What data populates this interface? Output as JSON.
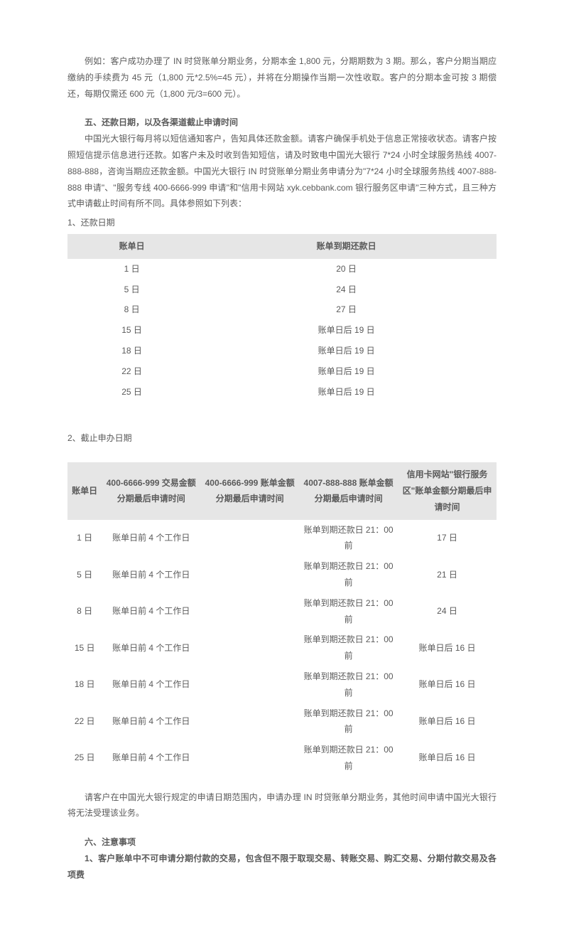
{
  "intro": "例如：客户成功办理了 IN 时贷账单分期业务，分期本金 1,800 元，分期期数为 3 期。那么，客户分期当期应缴纳的手续费为 45 元（1,800 元*2.5%=45 元），并将在分期操作当期一次性收取。客户的分期本金可按 3 期偿还，每期仅需还 600 元（1,800 元/3=600 元）。",
  "section5": {
    "title": "五、还款日期，以及各渠道截止申请时间",
    "body": "中国光大银行每月将以短信通知客户，告知具体还款金额。请客户确保手机处于信息正常接收状态。请客户按照短信提示信息进行还款。如客户未及时收到告知短信，请及时致电中国光大银行 7*24 小时全球服务热线 4007-888-888，咨询当期应还款金额。中国光大银行 IN 时贷账单分期业务申请分为\"7*24 小时全球服务热线 4007-888-888 申请\"、\"服务专线 400-6666-999 申请\"和\"信用卡网站 xyk.cebbank.com 银行服务区申请\"三种方式，且三种方式申请截止时间有所不同。具体参照如下列表：",
    "label1": "1、还款日期",
    "table1": {
      "headers": [
        "账单日",
        "账单到期还款日"
      ],
      "rows": [
        [
          "1 日",
          "20 日"
        ],
        [
          "5 日",
          "24 日"
        ],
        [
          "8 日",
          "27 日"
        ],
        [
          "15 日",
          "账单日后 19 日"
        ],
        [
          "18 日",
          "账单日后 19 日"
        ],
        [
          "22 日",
          "账单日后 19 日"
        ],
        [
          "25 日",
          "账单日后 19 日"
        ]
      ]
    },
    "label2": "2、截止申办日期",
    "table2": {
      "headers": [
        "账单日",
        "400-6666-999 交易金额分期最后申请时间",
        "400-6666-999 账单金额分期最后申请时间",
        "4007-888-888 账单金额分期最后申请时间",
        "信用卡网站\"银行服务区\"账单金额分期最后申请时间"
      ],
      "rows": [
        [
          "1 日",
          "账单日前 4 个工作日",
          "",
          "账单到期还款日 21：00 前",
          "17 日"
        ],
        [
          "5 日",
          "账单日前 4 个工作日",
          "",
          "账单到期还款日 21：00 前",
          "21 日"
        ],
        [
          "8 日",
          "账单日前 4 个工作日",
          "",
          "账单到期还款日 21：00 前",
          "24 日"
        ],
        [
          "15 日",
          "账单日前 4 个工作日",
          "",
          "账单到期还款日 21：00 前",
          "账单日后 16 日"
        ],
        [
          "18 日",
          "账单日前 4 个工作日",
          "",
          "账单到期还款日 21：00 前",
          "账单日后 16 日"
        ],
        [
          "22 日",
          "账单日前 4 个工作日",
          "",
          "账单到期还款日 21：00 前",
          "账单日后 16 日"
        ],
        [
          "25 日",
          "账单日前 4 个工作日",
          "",
          "账单到期还款日 21：00 前",
          "账单日后 16 日"
        ]
      ]
    },
    "footer": "请客户在中国光大银行规定的申请日期范围内，申请办理 IN 时贷账单分期业务，其他时间申请中国光大银行将无法受理该业务。"
  },
  "section6": {
    "title": "六、注意事项",
    "item1": "1、客户账单中不可申请分期付款的交易，包含但不限于取现交易、转账交易、购汇交易、分期付款交易及各项费"
  }
}
